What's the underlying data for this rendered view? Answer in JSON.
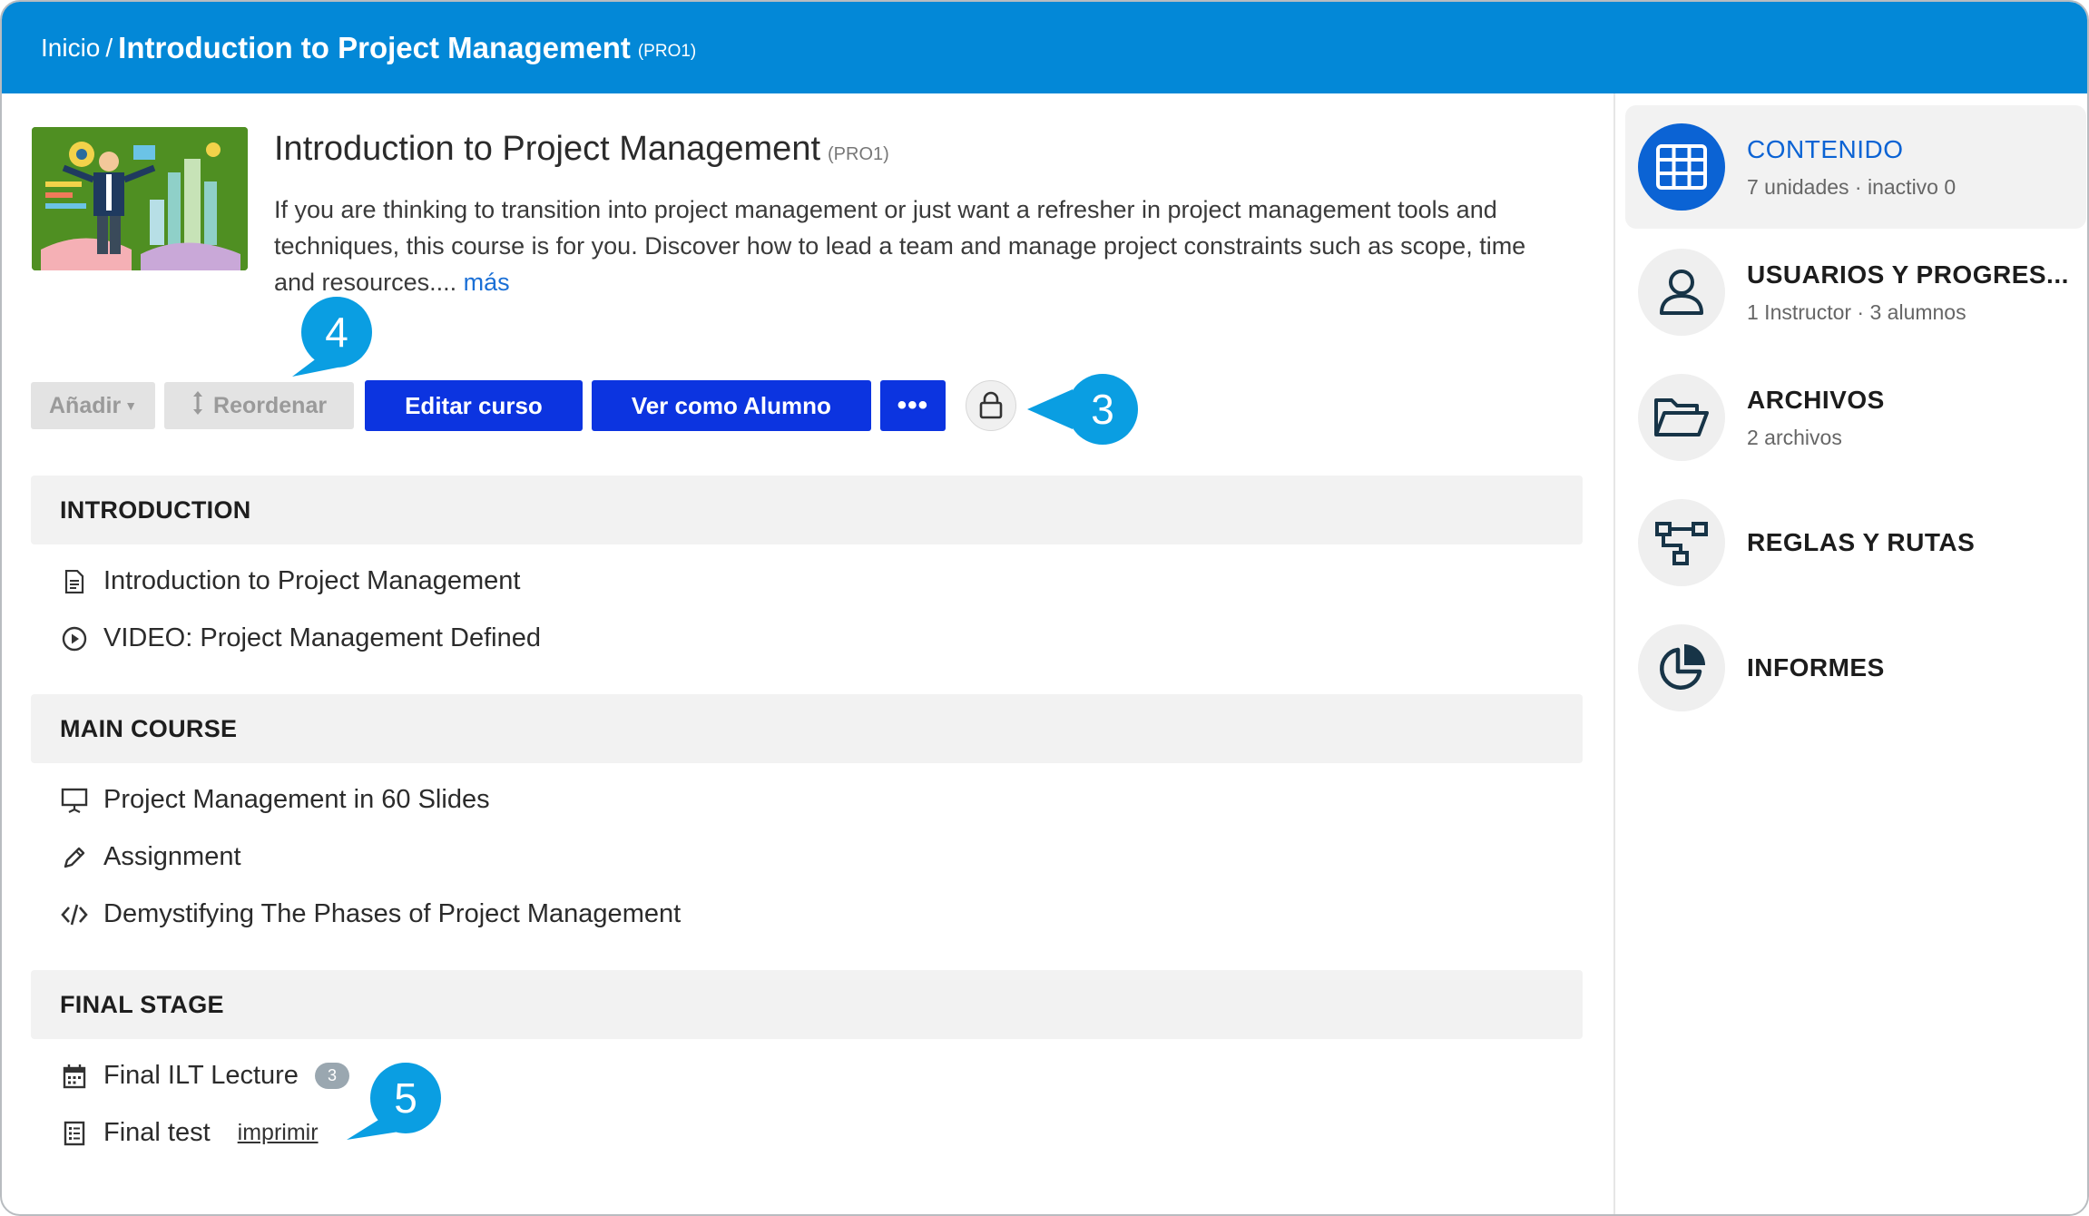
{
  "breadcrumb": {
    "home": "Inicio",
    "separator": "/",
    "title": "Introduction to Project Management",
    "code": "(PRO1)"
  },
  "course": {
    "title": "Introduction to Project Management",
    "code": "(PRO1)",
    "description": "If you are thinking to transition into project management or just want a refresher in project management tools and techniques, this course is for you. Discover how to lead a team and manage project constraints such as scope, time and resources.... ",
    "more_label": "más"
  },
  "toolbar": {
    "add_label": "Añadir",
    "reorder_label": "Reordenar",
    "edit_label": "Editar curso",
    "view_as_student_label": "Ver como Alumno",
    "more_label": "•••"
  },
  "callouts": [
    "4",
    "3",
    "5"
  ],
  "sections": [
    {
      "title": "INTRODUCTION",
      "units": [
        {
          "label": "Introduction to Project Management",
          "icon": "document-icon"
        },
        {
          "label": "VIDEO: Project Management Defined",
          "icon": "play-circle-icon"
        }
      ]
    },
    {
      "title": "MAIN COURSE",
      "units": [
        {
          "label": "Project Management in 60 Slides",
          "icon": "presentation-icon"
        },
        {
          "label": "Assignment",
          "icon": "pencil-icon"
        },
        {
          "label": "Demystifying The Phases of Project Management",
          "icon": "code-icon"
        }
      ]
    },
    {
      "title": "FINAL STAGE",
      "units": [
        {
          "label": "Final ILT Lecture",
          "icon": "calendar-icon",
          "badge": "3"
        },
        {
          "label": "Final test",
          "icon": "checklist-icon",
          "link": "imprimir"
        }
      ]
    }
  ],
  "sidebar": {
    "items": [
      {
        "title": "CONTENIDO",
        "sub": "7 unidades · inactivo 0",
        "icon": "grid-icon",
        "active": true
      },
      {
        "title": "USUARIOS Y PROGRES...",
        "sub": "1 Instructor · 3 alumnos",
        "icon": "user-icon"
      },
      {
        "title": "ARCHIVOS",
        "sub": "2 archivos",
        "icon": "folder-icon"
      },
      {
        "title": "REGLAS Y RUTAS",
        "icon": "rules-icon"
      },
      {
        "title": "INFORMES",
        "icon": "pie-chart-icon"
      }
    ]
  },
  "colors": {
    "header": "#0388d7",
    "primary_button": "#0c34e0",
    "callout": "#0a9ee2",
    "active_accent": "#0b63d4"
  }
}
